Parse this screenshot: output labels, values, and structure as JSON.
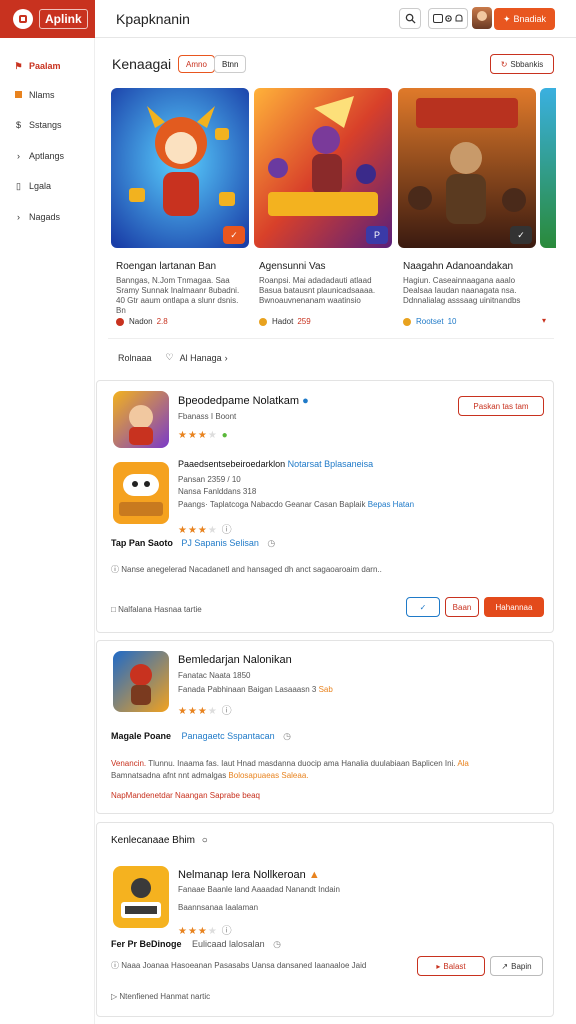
{
  "header": {
    "brand": "Aplink",
    "title": "Kpapknanin",
    "primary_button": "Bnadiak"
  },
  "sidebar": {
    "items": [
      {
        "label": "Paalam",
        "icon": "bookmark-icon",
        "active": true
      },
      {
        "label": "Nlams",
        "icon": "square-icon",
        "active": false
      },
      {
        "label": "Sstangs",
        "icon": "dollar-icon",
        "active": false
      },
      {
        "label": "Aptlangs",
        "icon": "chevron-right-icon",
        "active": false
      },
      {
        "label": "Lgala",
        "icon": "page-icon",
        "active": false
      },
      {
        "label": "Nagads",
        "icon": "chevron-right-icon",
        "active": false
      }
    ]
  },
  "featured": {
    "title": "Kenaagai",
    "chips": [
      "Amno",
      "Btnn"
    ],
    "see_all": "Sbbankis",
    "cards": [
      {
        "title": "Roengan lartanan Ban",
        "desc": "Banngas, N.Jom Tnmagaa. Saa Sramy Sunnak Inalmaanr 8ubadni. 40 Gtr aaum ontlapa a slunr dsnis. Bn",
        "meta": "Nadon",
        "meta_hl": "2.8",
        "badge": "✓",
        "dot": "#c8321f"
      },
      {
        "title": "Agensunni Vas",
        "desc": "Roanpsi. Mai adadadauti atlaad Basua batausnt plaunicadsaaaa. Bwnoauvnenanam waatinsio",
        "meta": "Hadot",
        "meta_hl": "259",
        "badge": "P",
        "dot": "#e8a21f"
      },
      {
        "title": "Naagahn Adanoandakan",
        "desc": "Hagiun. Caseainnaagana aaalo Dealsaa Iaudan naanagata nsa. Ddnnalialag asssaag uinitnandbs",
        "meta": "Rootset",
        "meta_hl": "10",
        "badge": "✓",
        "dot": "#e8a21f"
      }
    ]
  },
  "filter": {
    "left": "Rolnaaa",
    "right": "Al Hanaga"
  },
  "panel1": {
    "app1": {
      "title": "Bpeodedpame Nolatkam",
      "sub": "Fbanass I Boont",
      "rating": 3.5
    },
    "action1": "Paskan tas tam",
    "app2": {
      "title_a": "Paaedsentsebeiroedarklon",
      "title_b": "Notarsat Bplasaneisa",
      "l1": "Pansan  2359 / 10",
      "l2": "Nansa  Fanlddans  318",
      "l3a": "Paangs· Taplatcoga  Nabacdo Geanar Casan Baplaik",
      "l3b": "Bepas Hatan",
      "rating": 3.5
    },
    "tag_a": "Tap Pan Saoto",
    "tag_b": "PJ Sapanis Selisan",
    "note": "Nanse anegelerad Nacadanetl and hansaged dh anct sagaoaroaim darn..",
    "footer": "Nalfalana  Hasnaa tartie",
    "btn_share": "✓",
    "btn_small": "Baan",
    "btn_main": "Hahannaa"
  },
  "panel2": {
    "title": "Bemledarjan Nalonikan",
    "l1": "Fanatac  Naata  1850",
    "l2a": "Fanada  Pabhinaan Baigan Lasaaasn 3",
    "l2b": "Sab",
    "rating": 3.5,
    "tag_a": "Magale Poane",
    "tag_b": "Panagaetc Sspantacan",
    "desc_a": "Venancin.",
    "desc_b": "Tlunnu. Inaama fas. Iaut Hnad masdanna duocip ama Hanalia duulabiaan Baplicen Ini.",
    "desc_c": "Ala",
    "desc2_a": "Bamnatsadna  afnt nnt admalgas",
    "desc2_b": "Bolosapuaeas Saleaa.",
    "alert": "NapMandenetdar Naangan Saprabe beaq"
  },
  "panel3": {
    "header": "Kenlecanaae Bhim",
    "title": "Nelmanap Iera Nollkeroan",
    "l1": "Fanaae  Baanle land Aaaadad Nanandt Indain",
    "l2": "Baannsanaa Iaalaman",
    "rating": 3.5,
    "tag_a": "Fer Pr BeDinoge",
    "tag_b": "Eulicaad lalosalan",
    "note": "Naaa Joanaa Hasoeanan Pasasabs Uansa dansaned Iaanaaloe Jaid",
    "btn_a": "Balast",
    "btn_b": "Bapin",
    "footer": "Ntenfiened  Hanmat nartic"
  },
  "colors": {
    "brand": "#c8321f",
    "accent": "#e8561f",
    "star": "#e8831f",
    "link": "#1f7ac8"
  }
}
